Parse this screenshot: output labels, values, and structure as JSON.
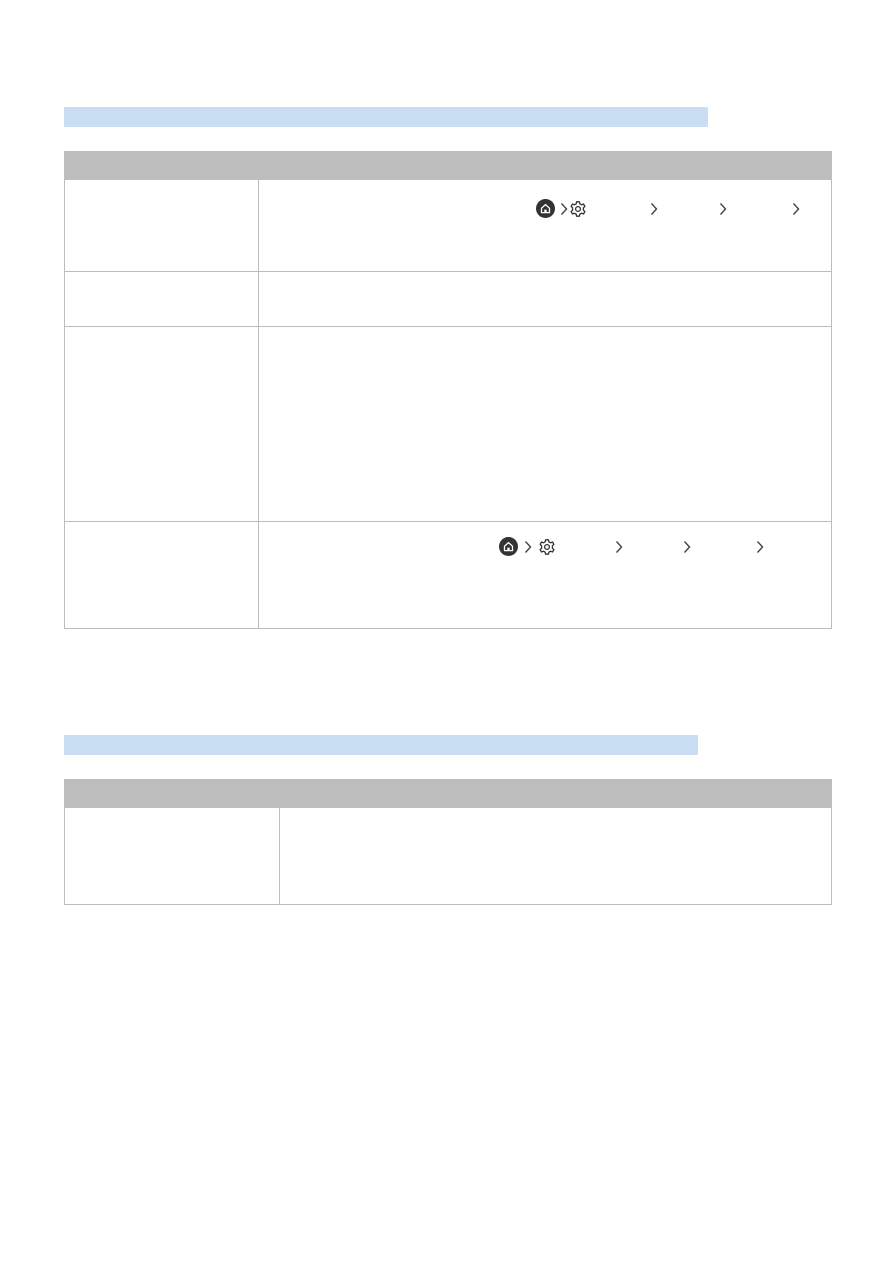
{
  "sections": [
    {
      "title": "",
      "table": {
        "headers": [
          "",
          ""
        ],
        "rows": [
          {
            "label": "",
            "description": "",
            "has_menu_path": true
          },
          {
            "label": "",
            "description": "",
            "has_menu_path": false
          },
          {
            "label": "",
            "description": "",
            "has_menu_path": false
          },
          {
            "label": "",
            "description": "",
            "has_menu_path": true
          }
        ]
      }
    },
    {
      "title": "",
      "table": {
        "headers": [
          "",
          ""
        ],
        "rows": [
          {
            "label": "",
            "description": "",
            "has_menu_path": false
          }
        ]
      }
    }
  ],
  "icons": {
    "home": "home-icon",
    "settings": "gear-icon",
    "separator": "chevron-right-icon"
  },
  "colors": {
    "section_bar": "#c9def2",
    "header_fill": "#bdbdbd",
    "border": "#bdbdbd",
    "icon_dark": "#333333"
  }
}
